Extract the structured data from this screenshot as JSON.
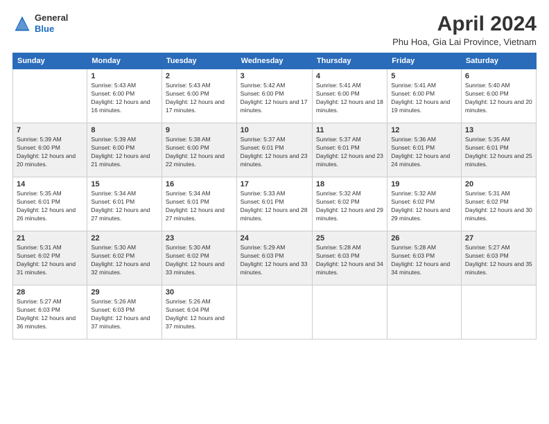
{
  "header": {
    "logo": {
      "general": "General",
      "blue": "Blue"
    },
    "title": "April 2024",
    "location": "Phu Hoa, Gia Lai Province, Vietnam"
  },
  "weekdays": [
    "Sunday",
    "Monday",
    "Tuesday",
    "Wednesday",
    "Thursday",
    "Friday",
    "Saturday"
  ],
  "weeks": [
    [
      {
        "day": "",
        "sunrise": "",
        "sunset": "",
        "daylight": ""
      },
      {
        "day": "1",
        "sunrise": "Sunrise: 5:43 AM",
        "sunset": "Sunset: 6:00 PM",
        "daylight": "Daylight: 12 hours and 16 minutes."
      },
      {
        "day": "2",
        "sunrise": "Sunrise: 5:43 AM",
        "sunset": "Sunset: 6:00 PM",
        "daylight": "Daylight: 12 hours and 17 minutes."
      },
      {
        "day": "3",
        "sunrise": "Sunrise: 5:42 AM",
        "sunset": "Sunset: 6:00 PM",
        "daylight": "Daylight: 12 hours and 17 minutes."
      },
      {
        "day": "4",
        "sunrise": "Sunrise: 5:41 AM",
        "sunset": "Sunset: 6:00 PM",
        "daylight": "Daylight: 12 hours and 18 minutes."
      },
      {
        "day": "5",
        "sunrise": "Sunrise: 5:41 AM",
        "sunset": "Sunset: 6:00 PM",
        "daylight": "Daylight: 12 hours and 19 minutes."
      },
      {
        "day": "6",
        "sunrise": "Sunrise: 5:40 AM",
        "sunset": "Sunset: 6:00 PM",
        "daylight": "Daylight: 12 hours and 20 minutes."
      }
    ],
    [
      {
        "day": "7",
        "sunrise": "Sunrise: 5:39 AM",
        "sunset": "Sunset: 6:00 PM",
        "daylight": "Daylight: 12 hours and 20 minutes."
      },
      {
        "day": "8",
        "sunrise": "Sunrise: 5:39 AM",
        "sunset": "Sunset: 6:00 PM",
        "daylight": "Daylight: 12 hours and 21 minutes."
      },
      {
        "day": "9",
        "sunrise": "Sunrise: 5:38 AM",
        "sunset": "Sunset: 6:00 PM",
        "daylight": "Daylight: 12 hours and 22 minutes."
      },
      {
        "day": "10",
        "sunrise": "Sunrise: 5:37 AM",
        "sunset": "Sunset: 6:01 PM",
        "daylight": "Daylight: 12 hours and 23 minutes."
      },
      {
        "day": "11",
        "sunrise": "Sunrise: 5:37 AM",
        "sunset": "Sunset: 6:01 PM",
        "daylight": "Daylight: 12 hours and 23 minutes."
      },
      {
        "day": "12",
        "sunrise": "Sunrise: 5:36 AM",
        "sunset": "Sunset: 6:01 PM",
        "daylight": "Daylight: 12 hours and 24 minutes."
      },
      {
        "day": "13",
        "sunrise": "Sunrise: 5:35 AM",
        "sunset": "Sunset: 6:01 PM",
        "daylight": "Daylight: 12 hours and 25 minutes."
      }
    ],
    [
      {
        "day": "14",
        "sunrise": "Sunrise: 5:35 AM",
        "sunset": "Sunset: 6:01 PM",
        "daylight": "Daylight: 12 hours and 26 minutes."
      },
      {
        "day": "15",
        "sunrise": "Sunrise: 5:34 AM",
        "sunset": "Sunset: 6:01 PM",
        "daylight": "Daylight: 12 hours and 27 minutes."
      },
      {
        "day": "16",
        "sunrise": "Sunrise: 5:34 AM",
        "sunset": "Sunset: 6:01 PM",
        "daylight": "Daylight: 12 hours and 27 minutes."
      },
      {
        "day": "17",
        "sunrise": "Sunrise: 5:33 AM",
        "sunset": "Sunset: 6:01 PM",
        "daylight": "Daylight: 12 hours and 28 minutes."
      },
      {
        "day": "18",
        "sunrise": "Sunrise: 5:32 AM",
        "sunset": "Sunset: 6:02 PM",
        "daylight": "Daylight: 12 hours and 29 minutes."
      },
      {
        "day": "19",
        "sunrise": "Sunrise: 5:32 AM",
        "sunset": "Sunset: 6:02 PM",
        "daylight": "Daylight: 12 hours and 29 minutes."
      },
      {
        "day": "20",
        "sunrise": "Sunrise: 5:31 AM",
        "sunset": "Sunset: 6:02 PM",
        "daylight": "Daylight: 12 hours and 30 minutes."
      }
    ],
    [
      {
        "day": "21",
        "sunrise": "Sunrise: 5:31 AM",
        "sunset": "Sunset: 6:02 PM",
        "daylight": "Daylight: 12 hours and 31 minutes."
      },
      {
        "day": "22",
        "sunrise": "Sunrise: 5:30 AM",
        "sunset": "Sunset: 6:02 PM",
        "daylight": "Daylight: 12 hours and 32 minutes."
      },
      {
        "day": "23",
        "sunrise": "Sunrise: 5:30 AM",
        "sunset": "Sunset: 6:02 PM",
        "daylight": "Daylight: 12 hours and 33 minutes."
      },
      {
        "day": "24",
        "sunrise": "Sunrise: 5:29 AM",
        "sunset": "Sunset: 6:03 PM",
        "daylight": "Daylight: 12 hours and 33 minutes."
      },
      {
        "day": "25",
        "sunrise": "Sunrise: 5:28 AM",
        "sunset": "Sunset: 6:03 PM",
        "daylight": "Daylight: 12 hours and 34 minutes."
      },
      {
        "day": "26",
        "sunrise": "Sunrise: 5:28 AM",
        "sunset": "Sunset: 6:03 PM",
        "daylight": "Daylight: 12 hours and 34 minutes."
      },
      {
        "day": "27",
        "sunrise": "Sunrise: 5:27 AM",
        "sunset": "Sunset: 6:03 PM",
        "daylight": "Daylight: 12 hours and 35 minutes."
      }
    ],
    [
      {
        "day": "28",
        "sunrise": "Sunrise: 5:27 AM",
        "sunset": "Sunset: 6:03 PM",
        "daylight": "Daylight: 12 hours and 36 minutes."
      },
      {
        "day": "29",
        "sunrise": "Sunrise: 5:26 AM",
        "sunset": "Sunset: 6:03 PM",
        "daylight": "Daylight: 12 hours and 37 minutes."
      },
      {
        "day": "30",
        "sunrise": "Sunrise: 5:26 AM",
        "sunset": "Sunset: 6:04 PM",
        "daylight": "Daylight: 12 hours and 37 minutes."
      },
      {
        "day": "",
        "sunrise": "",
        "sunset": "",
        "daylight": ""
      },
      {
        "day": "",
        "sunrise": "",
        "sunset": "",
        "daylight": ""
      },
      {
        "day": "",
        "sunrise": "",
        "sunset": "",
        "daylight": ""
      },
      {
        "day": "",
        "sunrise": "",
        "sunset": "",
        "daylight": ""
      }
    ]
  ]
}
